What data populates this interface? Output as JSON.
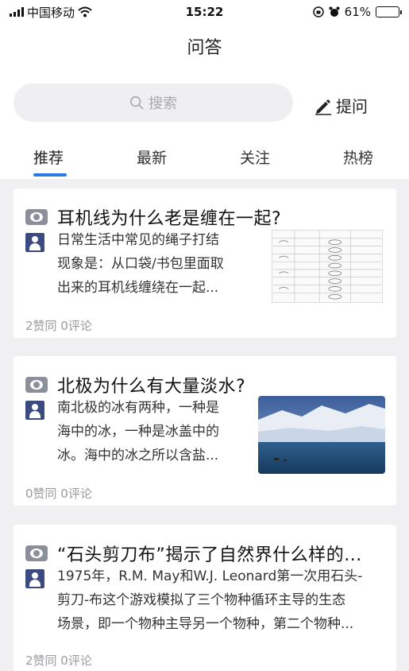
{
  "status_bar": {
    "carrier": "中国移动",
    "time": "15:22",
    "battery": "61%",
    "battery_level": 0.61
  },
  "header": {
    "title": "问答",
    "search_placeholder": "搜索",
    "ask_label": "提问"
  },
  "tabs": [
    {
      "label": "推荐",
      "active": true
    },
    {
      "label": "最新",
      "active": false
    },
    {
      "label": "关注",
      "active": false
    },
    {
      "label": "热榜",
      "active": false
    }
  ],
  "questions": [
    {
      "title": "耳机线为什么老是缠在一起?",
      "excerpt_lines": [
        "日常生活中常见的绳子打结",
        "现象是：从口袋/书包里面取",
        "出来的耳机线缠绕在一起..."
      ],
      "meta": "2赞同 0评论",
      "thumbnail": "table-image"
    },
    {
      "title": "北极为什么有大量淡水?",
      "excerpt_lines": [
        "南北极的冰有两种，一种是",
        "海中的冰，一种是冰盖中的",
        "冰。海中的冰之所以含盐..."
      ],
      "meta": "0赞同 0评论",
      "thumbnail": "glacier-photo"
    },
    {
      "title": "“石头剪刀布”揭示了自然界什么样的...",
      "excerpt_lines": [
        "1975年，R.M. May和W.J. Leonard第一次用石头-",
        "剪刀-布这个游戏模拟了三个物种循环主导的生态",
        "场景，即一个物种主导另一个物种，第二个物种..."
      ],
      "meta": "2赞同 0评论",
      "thumbnail": null
    }
  ]
}
